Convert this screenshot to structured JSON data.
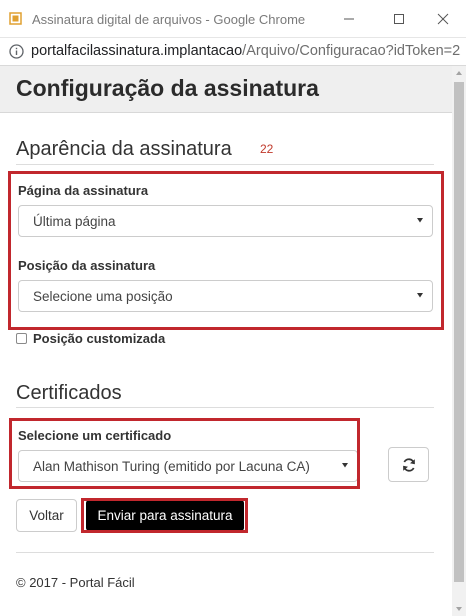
{
  "window": {
    "title": "Assinatura digital de arquivos - Google Chrome",
    "url_host": "portalfacilassinatura.implantacao",
    "url_path": "/Arquivo/Configuracao?idToken=22..."
  },
  "page": {
    "title": "Configuração da assinatura",
    "appearance_section": {
      "title": "Aparência da assinatura",
      "count": "22",
      "page_label": "Página da assinatura",
      "page_value": "Última página",
      "position_label": "Posição da assinatura",
      "position_value": "Selecione uma posição",
      "custom_position_label": "Posição customizada",
      "custom_position_checked": false
    },
    "certificates_section": {
      "title": "Certificados",
      "select_label": "Selecione um certificado",
      "select_value": "Alan Mathison Turing (emitido por Lacuna CA)"
    },
    "buttons": {
      "back": "Voltar",
      "submit": "Enviar para assinatura"
    },
    "footer": "© 2017 - Portal Fácil"
  },
  "colors": {
    "highlight": "#c1272d",
    "submit_bg": "#000000",
    "count_text": "#c0392b",
    "header_bg": "#efefef"
  },
  "icons": {
    "app": "document-icon",
    "info": "info-icon",
    "refresh": "refresh-icon",
    "caret": "chevron-down-icon"
  }
}
